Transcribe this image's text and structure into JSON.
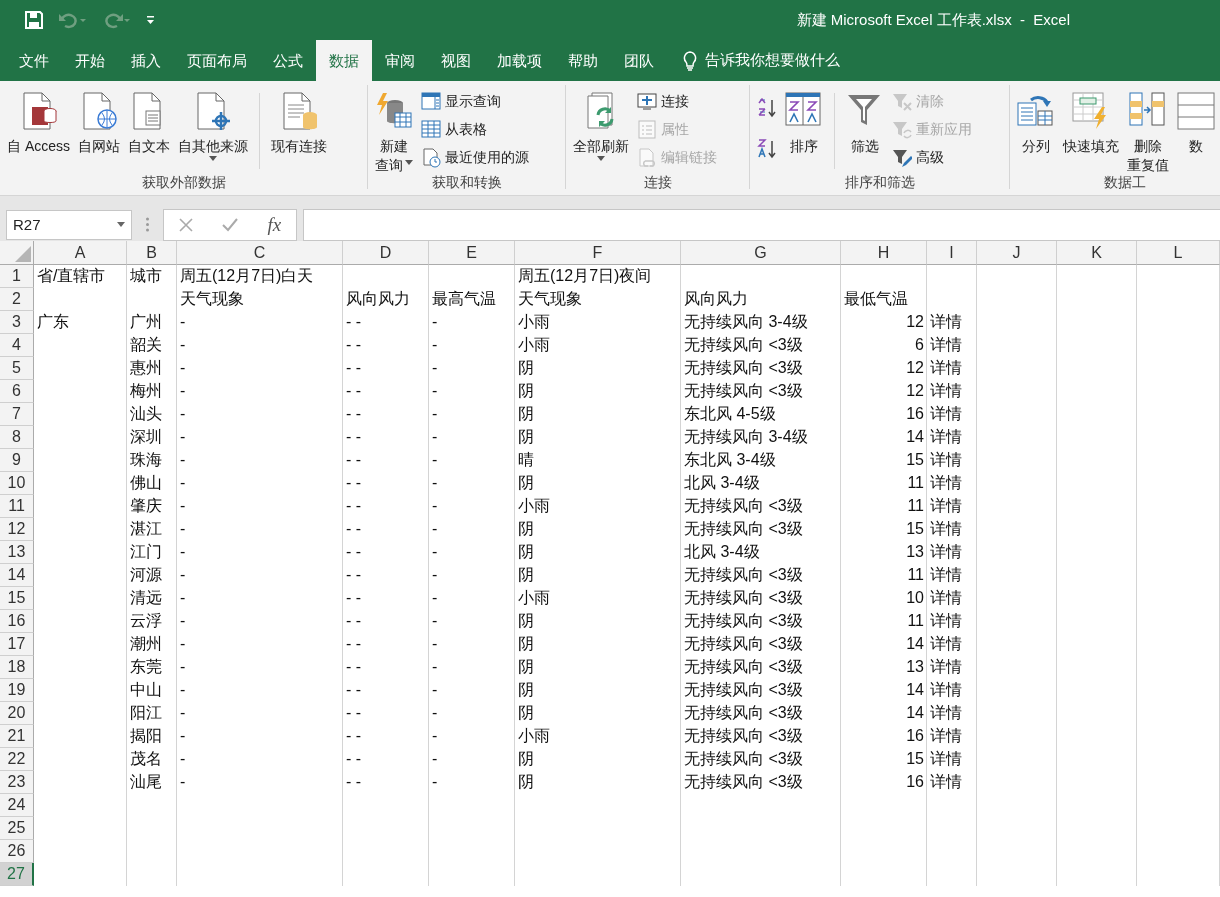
{
  "title_bar": {
    "title": "新建 Microsoft Excel 工作表.xlsx  -  Excel",
    "quick_access": [
      {
        "kind": "save",
        "disabled": false
      },
      {
        "kind": "undo",
        "disabled": true
      },
      {
        "kind": "redo",
        "disabled": true
      },
      {
        "kind": "customize",
        "disabled": false
      }
    ]
  },
  "tabs": [
    {
      "label": "文件",
      "selected": false
    },
    {
      "label": "开始",
      "selected": false
    },
    {
      "label": "插入",
      "selected": false
    },
    {
      "label": "页面布局",
      "selected": false
    },
    {
      "label": "公式",
      "selected": false
    },
    {
      "label": "数据",
      "selected": true
    },
    {
      "label": "审阅",
      "selected": false
    },
    {
      "label": "视图",
      "selected": false
    },
    {
      "label": "加载项",
      "selected": false
    },
    {
      "label": "帮助",
      "selected": false
    },
    {
      "label": "团队",
      "selected": false
    }
  ],
  "tell_me": "告诉我你想要做什么",
  "ribbon": [
    {
      "label": "获取外部数据",
      "items": [
        {
          "kind": "large",
          "lines": [
            "自 Access"
          ],
          "menu": false,
          "disabled": false
        },
        {
          "kind": "large",
          "lines": [
            "自网站"
          ],
          "menu": false,
          "disabled": false
        },
        {
          "kind": "large",
          "lines": [
            "自文本"
          ],
          "menu": false,
          "disabled": false
        },
        {
          "kind": "large",
          "lines": [
            "自其他来源"
          ],
          "menu": true,
          "disabled": false
        },
        {
          "kind": "separator"
        },
        {
          "kind": "large",
          "lines": [
            "现有连接"
          ],
          "menu": false,
          "disabled": false
        }
      ]
    },
    {
      "label": "获取和转换",
      "items": [
        {
          "kind": "large",
          "lines": [
            "新建",
            "查询"
          ],
          "menu": true,
          "disabled": false
        },
        {
          "kind": "small",
          "lines": [
            "显示查询"
          ],
          "disabled": false
        },
        {
          "kind": "small",
          "lines": [
            "从表格"
          ],
          "disabled": false
        },
        {
          "kind": "small",
          "lines": [
            "最近使用的源"
          ],
          "disabled": false
        }
      ]
    },
    {
      "label": "连接",
      "items": [
        {
          "kind": "large",
          "lines": [
            "全部刷新"
          ],
          "menu": true,
          "disabled": false
        },
        {
          "kind": "small",
          "lines": [
            "连接"
          ],
          "disabled": false
        },
        {
          "kind": "small",
          "lines": [
            "属性"
          ],
          "disabled": true
        },
        {
          "kind": "small",
          "lines": [
            "编辑链接"
          ],
          "disabled": true
        }
      ]
    },
    {
      "label": "排序和筛选",
      "items": [
        {
          "kind": "icon",
          "disabled": false
        },
        {
          "kind": "icon",
          "disabled": false
        },
        {
          "kind": "large",
          "lines": [
            "排序"
          ],
          "menu": false,
          "disabled": false
        },
        {
          "kind": "separator"
        },
        {
          "kind": "large",
          "lines": [
            "筛选"
          ],
          "menu": false,
          "disabled": false
        },
        {
          "kind": "small",
          "lines": [
            "清除"
          ],
          "disabled": true
        },
        {
          "kind": "small",
          "lines": [
            "重新应用"
          ],
          "disabled": true
        },
        {
          "kind": "small",
          "lines": [
            "高级"
          ],
          "disabled": false
        }
      ]
    },
    {
      "label": "数据工",
      "items": [
        {
          "kind": "large",
          "lines": [
            "分列"
          ],
          "menu": false,
          "disabled": false
        },
        {
          "kind": "large",
          "lines": [
            "快速填充"
          ],
          "menu": false,
          "disabled": false
        },
        {
          "kind": "large",
          "lines": [
            "删除",
            "重复值"
          ],
          "menu": false,
          "disabled": false
        },
        {
          "kind": "large",
          "lines": [
            "数"
          ],
          "menu": false,
          "disabled": false
        }
      ]
    }
  ],
  "formula_bar": {
    "name_box": "R27",
    "function_label": "fx"
  },
  "sheet": {
    "columns": [
      "A",
      "B",
      "C",
      "D",
      "E",
      "F",
      "G",
      "H",
      "I",
      "J",
      "K",
      "L"
    ],
    "rows": [
      {
        "number": "1",
        "kind": "header",
        "selected": false,
        "province": "省/直辖市",
        "city": "城市",
        "day_weather": "周五(12月7日)白天",
        "night_weather": "周五(12月7日)夜间"
      },
      {
        "number": "2",
        "kind": "header",
        "selected": false,
        "day_weather": "天气现象",
        "day_wind": "风向风力",
        "day_high": "最高气温",
        "night_weather": "天气现象",
        "night_wind": "风向风力",
        "night_low": "最低气温"
      },
      {
        "number": "3",
        "kind": "data",
        "selected": false,
        "province": "广东",
        "city": "广州",
        "day_weather": "-",
        "day_wind": "- -",
        "day_high": "-",
        "night_weather": "小雨",
        "night_wind": "无持续风向 3-4级",
        "night_low": "12",
        "details": "详情"
      },
      {
        "number": "4",
        "kind": "data",
        "selected": false,
        "city": "韶关",
        "day_weather": "-",
        "day_wind": "- -",
        "day_high": "-",
        "night_weather": "小雨",
        "night_wind": "无持续风向 <3级",
        "night_low": "6",
        "details": "详情"
      },
      {
        "number": "5",
        "kind": "data",
        "selected": false,
        "city": "惠州",
        "day_weather": "-",
        "day_wind": "- -",
        "day_high": "-",
        "night_weather": "阴",
        "night_wind": "无持续风向 <3级",
        "night_low": "12",
        "details": "详情"
      },
      {
        "number": "6",
        "kind": "data",
        "selected": false,
        "city": "梅州",
        "day_weather": "-",
        "day_wind": "- -",
        "day_high": "-",
        "night_weather": "阴",
        "night_wind": "无持续风向 <3级",
        "night_low": "12",
        "details": "详情"
      },
      {
        "number": "7",
        "kind": "data",
        "selected": false,
        "city": "汕头",
        "day_weather": "-",
        "day_wind": "- -",
        "day_high": "-",
        "night_weather": "阴",
        "night_wind": "东北风 4-5级",
        "night_low": "16",
        "details": "详情"
      },
      {
        "number": "8",
        "kind": "data",
        "selected": false,
        "city": "深圳",
        "day_weather": "-",
        "day_wind": "- -",
        "day_high": "-",
        "night_weather": "阴",
        "night_wind": "无持续风向 3-4级",
        "night_low": "14",
        "details": "详情"
      },
      {
        "number": "9",
        "kind": "data",
        "selected": false,
        "city": "珠海",
        "day_weather": "-",
        "day_wind": "- -",
        "day_high": "-",
        "night_weather": "晴",
        "night_wind": "东北风 3-4级",
        "night_low": "15",
        "details": "详情"
      },
      {
        "number": "10",
        "kind": "data",
        "selected": false,
        "city": "佛山",
        "day_weather": "-",
        "day_wind": "- -",
        "day_high": "-",
        "night_weather": "阴",
        "night_wind": "北风 3-4级",
        "night_low": "11",
        "details": "详情"
      },
      {
        "number": "11",
        "kind": "data",
        "selected": false,
        "city": "肇庆",
        "day_weather": "-",
        "day_wind": "- -",
        "day_high": "-",
        "night_weather": "小雨",
        "night_wind": "无持续风向 <3级",
        "night_low": "11",
        "details": "详情"
      },
      {
        "number": "12",
        "kind": "data",
        "selected": false,
        "city": "湛江",
        "day_weather": "-",
        "day_wind": "- -",
        "day_high": "-",
        "night_weather": "阴",
        "night_wind": "无持续风向 <3级",
        "night_low": "15",
        "details": "详情"
      },
      {
        "number": "13",
        "kind": "data",
        "selected": false,
        "city": "江门",
        "day_weather": "-",
        "day_wind": "- -",
        "day_high": "-",
        "night_weather": "阴",
        "night_wind": "北风 3-4级",
        "night_low": "13",
        "details": "详情"
      },
      {
        "number": "14",
        "kind": "data",
        "selected": false,
        "city": "河源",
        "day_weather": "-",
        "day_wind": "- -",
        "day_high": "-",
        "night_weather": "阴",
        "night_wind": "无持续风向 <3级",
        "night_low": "11",
        "details": "详情"
      },
      {
        "number": "15",
        "kind": "data",
        "selected": false,
        "city": "清远",
        "day_weather": "-",
        "day_wind": "- -",
        "day_high": "-",
        "night_weather": "小雨",
        "night_wind": "无持续风向 <3级",
        "night_low": "10",
        "details": "详情"
      },
      {
        "number": "16",
        "kind": "data",
        "selected": false,
        "city": "云浮",
        "day_weather": "-",
        "day_wind": "- -",
        "day_high": "-",
        "night_weather": "阴",
        "night_wind": "无持续风向 <3级",
        "night_low": "11",
        "details": "详情"
      },
      {
        "number": "17",
        "kind": "data",
        "selected": false,
        "city": "潮州",
        "day_weather": "-",
        "day_wind": "- -",
        "day_high": "-",
        "night_weather": "阴",
        "night_wind": "无持续风向 <3级",
        "night_low": "14",
        "details": "详情"
      },
      {
        "number": "18",
        "kind": "data",
        "selected": false,
        "city": "东莞",
        "day_weather": "-",
        "day_wind": "- -",
        "day_high": "-",
        "night_weather": "阴",
        "night_wind": "无持续风向 <3级",
        "night_low": "13",
        "details": "详情"
      },
      {
        "number": "19",
        "kind": "data",
        "selected": false,
        "city": "中山",
        "day_weather": "-",
        "day_wind": "- -",
        "day_high": "-",
        "night_weather": "阴",
        "night_wind": "无持续风向 <3级",
        "night_low": "14",
        "details": "详情"
      },
      {
        "number": "20",
        "kind": "data",
        "selected": false,
        "city": "阳江",
        "day_weather": "-",
        "day_wind": "- -",
        "day_high": "-",
        "night_weather": "阴",
        "night_wind": "无持续风向 <3级",
        "night_low": "14",
        "details": "详情"
      },
      {
        "number": "21",
        "kind": "data",
        "selected": false,
        "city": "揭阳",
        "day_weather": "-",
        "day_wind": "- -",
        "day_high": "-",
        "night_weather": "小雨",
        "night_wind": "无持续风向 <3级",
        "night_low": "16",
        "details": "详情"
      },
      {
        "number": "22",
        "kind": "data",
        "selected": false,
        "city": "茂名",
        "day_weather": "-",
        "day_wind": "- -",
        "day_high": "-",
        "night_weather": "阴",
        "night_wind": "无持续风向 <3级",
        "night_low": "15",
        "details": "详情"
      },
      {
        "number": "23",
        "kind": "data",
        "selected": false,
        "city": "汕尾",
        "day_weather": "-",
        "day_wind": "- -",
        "day_high": "-",
        "night_weather": "阴",
        "night_wind": "无持续风向 <3级",
        "night_low": "16",
        "details": "详情"
      },
      {
        "number": "24",
        "kind": "data",
        "selected": false
      },
      {
        "number": "25",
        "kind": "data",
        "selected": false
      },
      {
        "number": "26",
        "kind": "data",
        "selected": false
      },
      {
        "number": "27",
        "kind": "data",
        "selected": true
      }
    ]
  }
}
